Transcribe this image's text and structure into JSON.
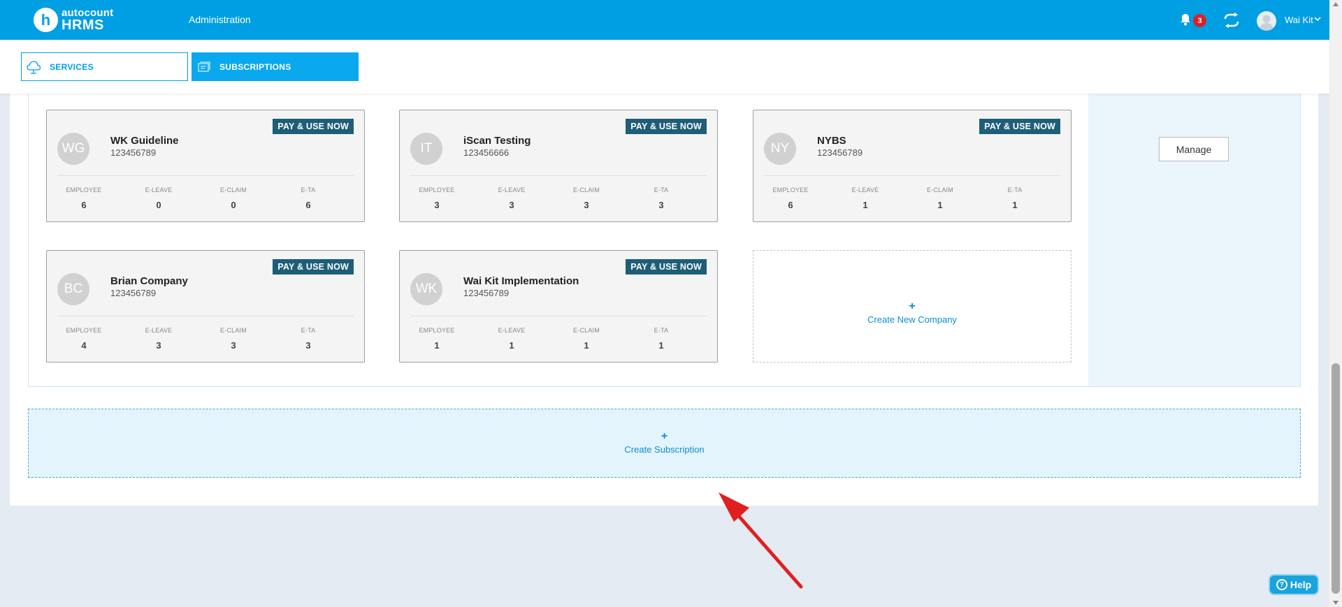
{
  "header": {
    "logo_letter": "h",
    "logo_line1": "autocount",
    "logo_line2": "HRMS",
    "nav_title": "Administration",
    "notification_count": "3",
    "user_name": "Wai Kit"
  },
  "tabs": [
    {
      "label": "SERVICES",
      "icon": "cloud-icon",
      "active": false
    },
    {
      "label": "SUBSCRIPTIONS",
      "icon": "subscription-icon",
      "active": true
    }
  ],
  "stat_labels": {
    "employee": "EMPLOYEE",
    "eleave": "E-LEAVE",
    "eclaim": "E-CLAIM",
    "eta": "E-TA"
  },
  "pay_label": "PAY & USE NOW",
  "companies": [
    {
      "initials": "WG",
      "name": "WK Guideline",
      "number": "123456789",
      "employee": "6",
      "eleave": "0",
      "eclaim": "0",
      "eta": "6"
    },
    {
      "initials": "IT",
      "name": "iScan Testing",
      "number": "123456666",
      "employee": "3",
      "eleave": "3",
      "eclaim": "3",
      "eta": "3"
    },
    {
      "initials": "NY",
      "name": "NYBS",
      "number": "123456789",
      "employee": "6",
      "eleave": "1",
      "eclaim": "1",
      "eta": "1"
    },
    {
      "initials": "BC",
      "name": "Brian Company",
      "number": "123456789",
      "employee": "4",
      "eleave": "3",
      "eclaim": "3",
      "eta": "3"
    },
    {
      "initials": "WK",
      "name": "Wai Kit Implementation",
      "number": "123456789",
      "employee": "1",
      "eleave": "1",
      "eclaim": "1",
      "eta": "1"
    }
  ],
  "create_company": {
    "plus": "+",
    "label": "Create New Company"
  },
  "manage_label": "Manage",
  "create_subscription": {
    "plus": "+",
    "label": "Create Subscription"
  },
  "help_label": "Help",
  "colors": {
    "primary": "#009fe3",
    "pay_badge": "#1e5e78",
    "badge_red": "#d8222a",
    "link": "#0a8fd0"
  }
}
